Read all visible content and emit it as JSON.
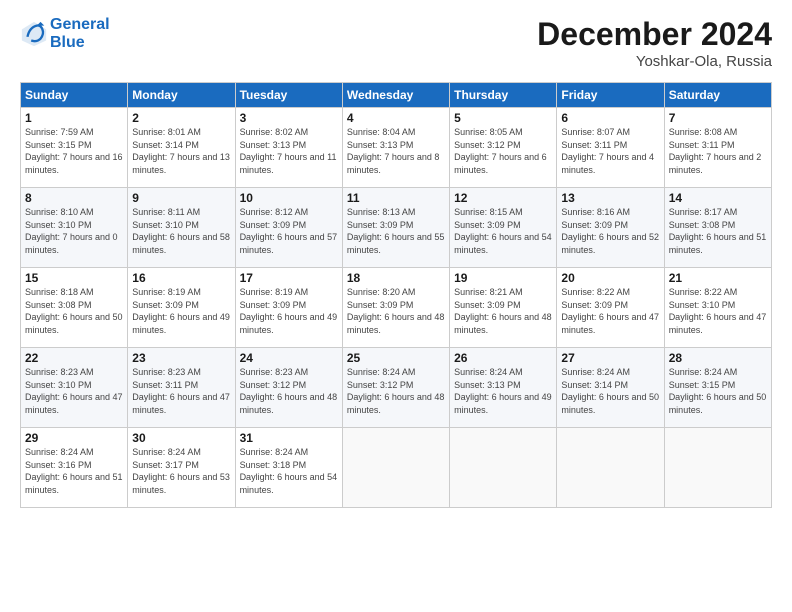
{
  "header": {
    "logo_line1": "General",
    "logo_line2": "Blue",
    "month": "December 2024",
    "location": "Yoshkar-Ola, Russia"
  },
  "weekdays": [
    "Sunday",
    "Monday",
    "Tuesday",
    "Wednesday",
    "Thursday",
    "Friday",
    "Saturday"
  ],
  "weeks": [
    [
      {
        "day": "1",
        "sunrise": "Sunrise: 7:59 AM",
        "sunset": "Sunset: 3:15 PM",
        "daylight": "Daylight: 7 hours and 16 minutes."
      },
      {
        "day": "2",
        "sunrise": "Sunrise: 8:01 AM",
        "sunset": "Sunset: 3:14 PM",
        "daylight": "Daylight: 7 hours and 13 minutes."
      },
      {
        "day": "3",
        "sunrise": "Sunrise: 8:02 AM",
        "sunset": "Sunset: 3:13 PM",
        "daylight": "Daylight: 7 hours and 11 minutes."
      },
      {
        "day": "4",
        "sunrise": "Sunrise: 8:04 AM",
        "sunset": "Sunset: 3:13 PM",
        "daylight": "Daylight: 7 hours and 8 minutes."
      },
      {
        "day": "5",
        "sunrise": "Sunrise: 8:05 AM",
        "sunset": "Sunset: 3:12 PM",
        "daylight": "Daylight: 7 hours and 6 minutes."
      },
      {
        "day": "6",
        "sunrise": "Sunrise: 8:07 AM",
        "sunset": "Sunset: 3:11 PM",
        "daylight": "Daylight: 7 hours and 4 minutes."
      },
      {
        "day": "7",
        "sunrise": "Sunrise: 8:08 AM",
        "sunset": "Sunset: 3:11 PM",
        "daylight": "Daylight: 7 hours and 2 minutes."
      }
    ],
    [
      {
        "day": "8",
        "sunrise": "Sunrise: 8:10 AM",
        "sunset": "Sunset: 3:10 PM",
        "daylight": "Daylight: 7 hours and 0 minutes."
      },
      {
        "day": "9",
        "sunrise": "Sunrise: 8:11 AM",
        "sunset": "Sunset: 3:10 PM",
        "daylight": "Daylight: 6 hours and 58 minutes."
      },
      {
        "day": "10",
        "sunrise": "Sunrise: 8:12 AM",
        "sunset": "Sunset: 3:09 PM",
        "daylight": "Daylight: 6 hours and 57 minutes."
      },
      {
        "day": "11",
        "sunrise": "Sunrise: 8:13 AM",
        "sunset": "Sunset: 3:09 PM",
        "daylight": "Daylight: 6 hours and 55 minutes."
      },
      {
        "day": "12",
        "sunrise": "Sunrise: 8:15 AM",
        "sunset": "Sunset: 3:09 PM",
        "daylight": "Daylight: 6 hours and 54 minutes."
      },
      {
        "day": "13",
        "sunrise": "Sunrise: 8:16 AM",
        "sunset": "Sunset: 3:09 PM",
        "daylight": "Daylight: 6 hours and 52 minutes."
      },
      {
        "day": "14",
        "sunrise": "Sunrise: 8:17 AM",
        "sunset": "Sunset: 3:08 PM",
        "daylight": "Daylight: 6 hours and 51 minutes."
      }
    ],
    [
      {
        "day": "15",
        "sunrise": "Sunrise: 8:18 AM",
        "sunset": "Sunset: 3:08 PM",
        "daylight": "Daylight: 6 hours and 50 minutes."
      },
      {
        "day": "16",
        "sunrise": "Sunrise: 8:19 AM",
        "sunset": "Sunset: 3:09 PM",
        "daylight": "Daylight: 6 hours and 49 minutes."
      },
      {
        "day": "17",
        "sunrise": "Sunrise: 8:19 AM",
        "sunset": "Sunset: 3:09 PM",
        "daylight": "Daylight: 6 hours and 49 minutes."
      },
      {
        "day": "18",
        "sunrise": "Sunrise: 8:20 AM",
        "sunset": "Sunset: 3:09 PM",
        "daylight": "Daylight: 6 hours and 48 minutes."
      },
      {
        "day": "19",
        "sunrise": "Sunrise: 8:21 AM",
        "sunset": "Sunset: 3:09 PM",
        "daylight": "Daylight: 6 hours and 48 minutes."
      },
      {
        "day": "20",
        "sunrise": "Sunrise: 8:22 AM",
        "sunset": "Sunset: 3:09 PM",
        "daylight": "Daylight: 6 hours and 47 minutes."
      },
      {
        "day": "21",
        "sunrise": "Sunrise: 8:22 AM",
        "sunset": "Sunset: 3:10 PM",
        "daylight": "Daylight: 6 hours and 47 minutes."
      }
    ],
    [
      {
        "day": "22",
        "sunrise": "Sunrise: 8:23 AM",
        "sunset": "Sunset: 3:10 PM",
        "daylight": "Daylight: 6 hours and 47 minutes."
      },
      {
        "day": "23",
        "sunrise": "Sunrise: 8:23 AM",
        "sunset": "Sunset: 3:11 PM",
        "daylight": "Daylight: 6 hours and 47 minutes."
      },
      {
        "day": "24",
        "sunrise": "Sunrise: 8:23 AM",
        "sunset": "Sunset: 3:12 PM",
        "daylight": "Daylight: 6 hours and 48 minutes."
      },
      {
        "day": "25",
        "sunrise": "Sunrise: 8:24 AM",
        "sunset": "Sunset: 3:12 PM",
        "daylight": "Daylight: 6 hours and 48 minutes."
      },
      {
        "day": "26",
        "sunrise": "Sunrise: 8:24 AM",
        "sunset": "Sunset: 3:13 PM",
        "daylight": "Daylight: 6 hours and 49 minutes."
      },
      {
        "day": "27",
        "sunrise": "Sunrise: 8:24 AM",
        "sunset": "Sunset: 3:14 PM",
        "daylight": "Daylight: 6 hours and 50 minutes."
      },
      {
        "day": "28",
        "sunrise": "Sunrise: 8:24 AM",
        "sunset": "Sunset: 3:15 PM",
        "daylight": "Daylight: 6 hours and 50 minutes."
      }
    ],
    [
      {
        "day": "29",
        "sunrise": "Sunrise: 8:24 AM",
        "sunset": "Sunset: 3:16 PM",
        "daylight": "Daylight: 6 hours and 51 minutes."
      },
      {
        "day": "30",
        "sunrise": "Sunrise: 8:24 AM",
        "sunset": "Sunset: 3:17 PM",
        "daylight": "Daylight: 6 hours and 53 minutes."
      },
      {
        "day": "31",
        "sunrise": "Sunrise: 8:24 AM",
        "sunset": "Sunset: 3:18 PM",
        "daylight": "Daylight: 6 hours and 54 minutes."
      },
      null,
      null,
      null,
      null
    ]
  ]
}
